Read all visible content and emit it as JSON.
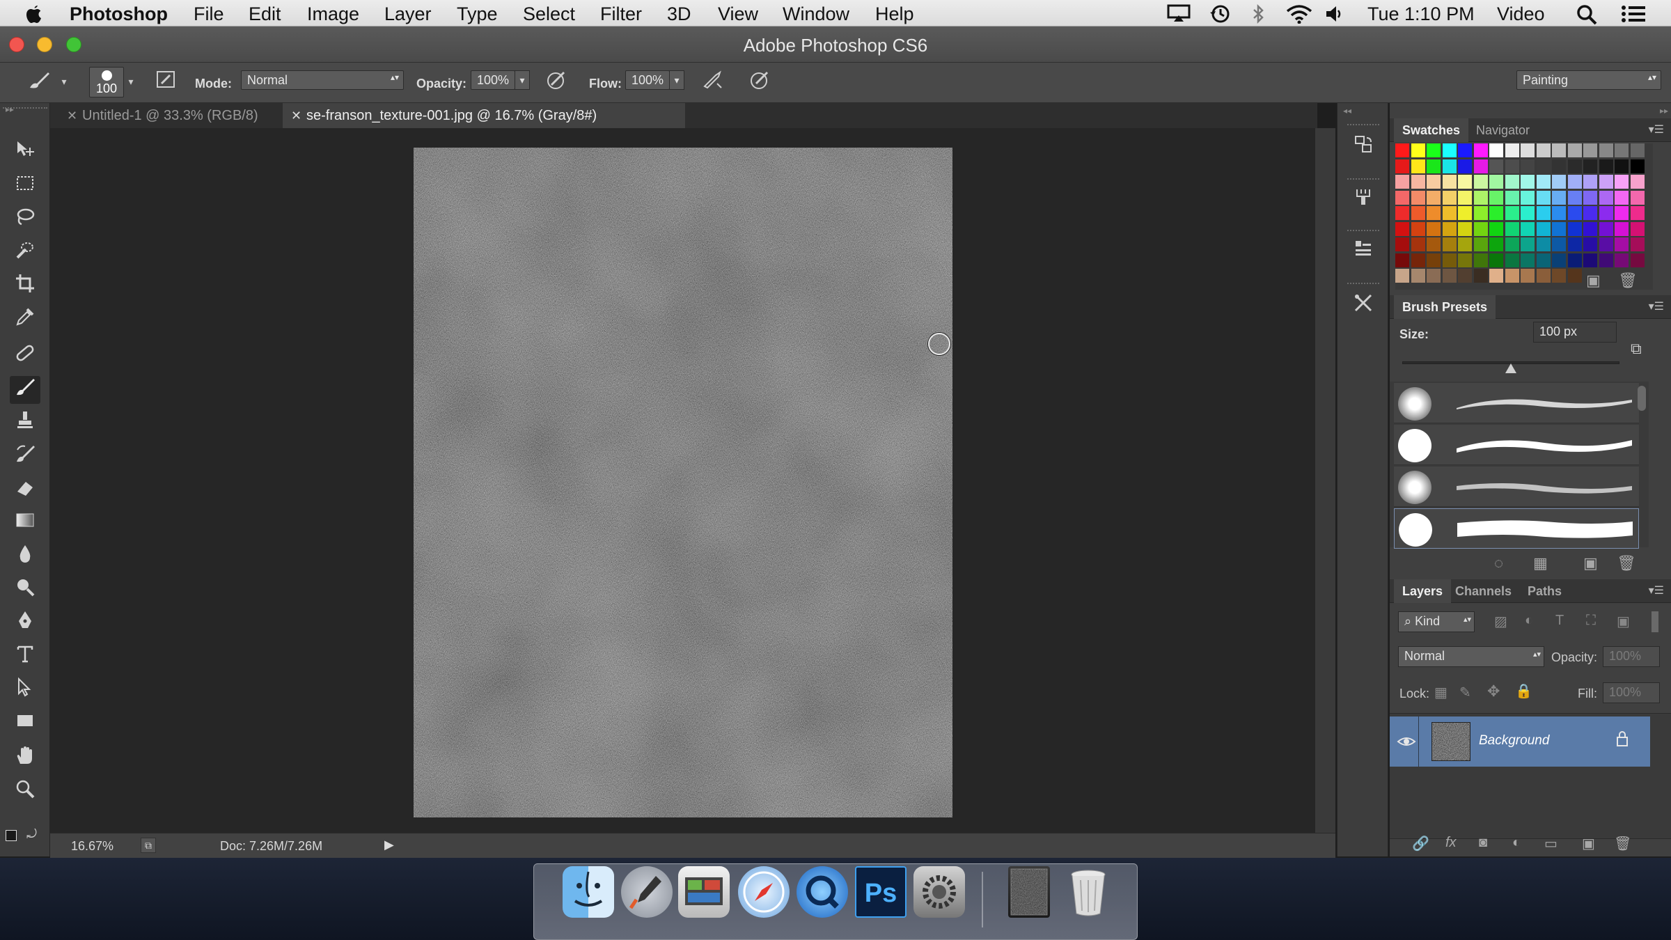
{
  "menubar": {
    "app": "Photoshop",
    "items": [
      "File",
      "Edit",
      "Image",
      "Layer",
      "Type",
      "Select",
      "Filter",
      "3D",
      "View",
      "Window",
      "Help"
    ],
    "clock": "Tue 1:10 PM",
    "right_label": "Video",
    "status_icons": [
      "airplay-icon",
      "time-machine-icon",
      "bluetooth-icon",
      "wifi-icon",
      "volume-icon",
      "spotlight-icon",
      "notifications-icon"
    ]
  },
  "window": {
    "title": "Adobe Photoshop CS6"
  },
  "options": {
    "brush_size": "100",
    "mode_label": "Mode:",
    "mode_value": "Normal",
    "opacity_label": "Opacity:",
    "opacity_value": "100%",
    "flow_label": "Flow:",
    "flow_value": "100%",
    "workspace": "Painting"
  },
  "tabs": [
    {
      "label": "Untitled-1 @ 33.3% (RGB/8)",
      "active": false
    },
    {
      "label": "se-franson_texture-001.jpg @ 16.7% (Gray/8#)",
      "active": true
    }
  ],
  "status": {
    "zoom": "16.67%",
    "doc": "Doc: 7.26M/7.26M"
  },
  "swatches_panel": {
    "tabs": [
      "Swatches",
      "Navigator"
    ]
  },
  "brush_presets": {
    "title": "Brush Presets",
    "size_label": "Size:",
    "size_value": "100 px",
    "size_slider_fraction": 0.5
  },
  "layers_panel": {
    "tabs": [
      "Layers",
      "Channels",
      "Paths"
    ],
    "kind_label": "Kind",
    "blend_mode": "Normal",
    "opacity_label": "Opacity:",
    "opacity_value": "100%",
    "lock_label": "Lock:",
    "fill_label": "Fill:",
    "fill_value": "100%",
    "layers": [
      {
        "name": "Background",
        "visible": true,
        "locked": true
      }
    ]
  },
  "colors": {
    "accent": "#3b74c6",
    "selected_layer": "#5a7ba8",
    "menubar_bg": "#e4e4e4"
  }
}
